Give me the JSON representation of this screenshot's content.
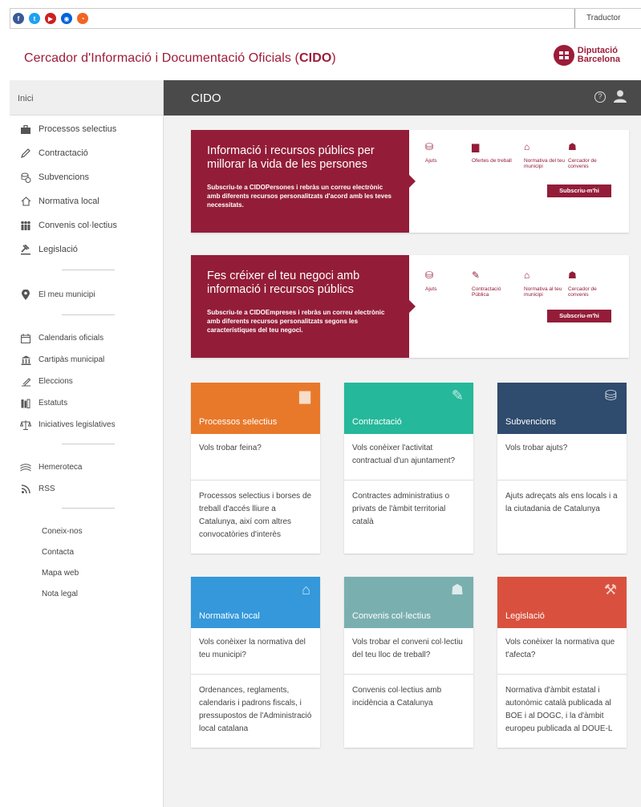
{
  "translator": "Traductor",
  "header": {
    "title_prefix": "Cercador d'Informació i Documentació Oficials (",
    "title_bold": "CIDO",
    "title_suffix": ")",
    "brand_line1": "Diputació",
    "brand_line2": "Barcelona"
  },
  "social": [
    {
      "name": "facebook",
      "color": "#3b5998",
      "glyph": "f"
    },
    {
      "name": "twitter",
      "color": "#1da1f2",
      "glyph": "t"
    },
    {
      "name": "youtube",
      "color": "#cd201f",
      "glyph": "▶"
    },
    {
      "name": "flickr",
      "color": "#0063dc",
      "glyph": "◉"
    },
    {
      "name": "rss",
      "color": "#f26522",
      "glyph": "◔"
    }
  ],
  "sidebar": {
    "home": "Inici",
    "main_items": [
      {
        "label": "Processos selectius",
        "icon": "briefcase-icon"
      },
      {
        "label": "Contractació",
        "icon": "pencil-icon"
      },
      {
        "label": "Subvencions",
        "icon": "coins-icon"
      },
      {
        "label": "Normativa local",
        "icon": "house-icon"
      },
      {
        "label": "Convenis col·lectius",
        "icon": "people-icon"
      },
      {
        "label": "Legislació",
        "icon": "gavel-icon"
      }
    ],
    "municipality": "El meu municipi",
    "secondary_items": [
      {
        "label": "Calendaris oficials",
        "icon": "calendar-icon"
      },
      {
        "label": "Cartipàs municipal",
        "icon": "building-icon"
      },
      {
        "label": "Eleccions",
        "icon": "ballot-icon"
      },
      {
        "label": "Estatuts",
        "icon": "books-icon"
      },
      {
        "label": "Iniciatives legislatives",
        "icon": "scales-icon"
      }
    ],
    "tertiary_items": [
      {
        "label": "Hemeroteca",
        "icon": "newspaper-icon"
      },
      {
        "label": "RSS",
        "icon": "rss-icon"
      }
    ],
    "links": [
      "Coneix-nos",
      "Contacta",
      "Mapa web",
      "Nota legal"
    ]
  },
  "main": {
    "title": "CIDO",
    "banners": [
      {
        "title": "Informació i recursos públics per millorar la vida de les persones",
        "text_pre": "Subscriu-te a ",
        "text_bold": "CIDOPersones",
        "text_post": " i rebràs un correu electrònic amb diferents recursos personalitzats d'acord amb les teves necessitats.",
        "icons": [
          {
            "label": "Ajuts",
            "icon": "coins-icon"
          },
          {
            "label": "Ofertes de treball",
            "icon": "briefcase-icon"
          },
          {
            "label": "Normativa del teu municipi",
            "icon": "house-icon"
          },
          {
            "label": "Cercador de convenis",
            "icon": "people-icon"
          }
        ],
        "button": "Subscriu-m'hi"
      },
      {
        "title": "Fes créixer el teu negoci amb informació i recursos públics",
        "text_pre": "Subscriu-te a ",
        "text_bold": "CIDOEmpreses",
        "text_post": " i rebràs un correu electrònic amb diferents recursos personalitzats segons les característiques del teu negoci.",
        "icons": [
          {
            "label": "Ajuts",
            "icon": "coins-icon"
          },
          {
            "label": "Contractació Pública",
            "icon": "pencil-icon"
          },
          {
            "label": "Normativa al teu municipi",
            "icon": "house-icon"
          },
          {
            "label": "Cercador de convenis",
            "icon": "people-icon"
          }
        ],
        "button": "Subscriu-m'hi"
      }
    ],
    "cards": [
      {
        "title": "Processos selectius",
        "color": "#e8792b",
        "icon": "briefcase-icon",
        "question": "Vols trobar feina?",
        "desc": "Processos selectius i borses de treball d'accés lliure a Catalunya, així com altres convocatòries d'interès"
      },
      {
        "title": "Contractació",
        "color": "#25b89a",
        "icon": "pencil-icon",
        "question": "Vols conèixer l'activitat contractual d'un ajuntament?",
        "desc": "Contractes administratius o privats de l'àmbit territorial català"
      },
      {
        "title": "Subvencions",
        "color": "#2f4b6e",
        "icon": "coins-icon",
        "question": "Vols trobar ajuts?",
        "desc": "Ajuts adreçats als ens locals i a la ciutadania de Catalunya"
      },
      {
        "title": "Normativa local",
        "color": "#3498db",
        "icon": "house-icon",
        "question": "Vols conèixer la normativa del teu municipi?",
        "desc": "Ordenances, reglaments, calendaris i padrons fiscals, i pressupostos de l'Administració local catalana"
      },
      {
        "title": "Convenis col·lectius",
        "color": "#7aafb0",
        "icon": "people-icon",
        "question": "Vols trobar el conveni col·lectiu del teu lloc de treball?",
        "desc": "Convenis col·lectius amb incidència a Catalunya"
      },
      {
        "title": "Legislació",
        "color": "#d9513e",
        "icon": "gavel-icon",
        "question": "Vols conèixer la normativa que t'afecta?",
        "desc": "Normativa d'àmbit estatal i autonòmic català publicada al BOE i al DOGC, i la d'àmbit europeu publicada al DOUE-L"
      }
    ]
  }
}
